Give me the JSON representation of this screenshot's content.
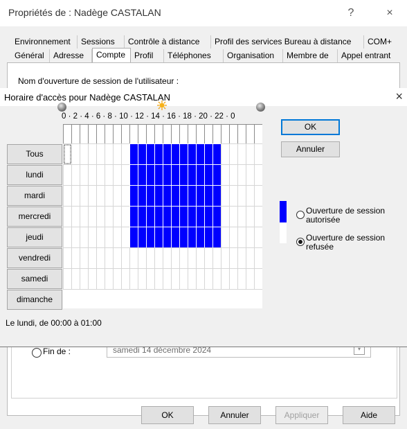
{
  "window": {
    "title": "Propriétés de : Nadège CASTALAN",
    "help": "?",
    "close": "×"
  },
  "tabs_row1": [
    "Environnement",
    "Sessions",
    "Contrôle à distance",
    "Profil des services Bureau à distance",
    "COM+"
  ],
  "tabs_row2": [
    "Général",
    "Adresse",
    "Compte",
    "Profil",
    "Téléphones",
    "Organisation",
    "Membre de",
    "Appel entrant"
  ],
  "selected_tab": "Compte",
  "behind": {
    "logon_label": "Nom d'ouverture de session de l'utilisateur :",
    "end_label": "Fin de :",
    "end_date": "samedi   14 décembre 2024"
  },
  "bottom_buttons": {
    "ok": "OK",
    "cancel": "Annuler",
    "apply": "Appliquer",
    "help": "Aide"
  },
  "dialog": {
    "title": "Horaire d'accès pour Nadège CASTALAN",
    "close": "×",
    "hour_scale": "0 · 2 · 4 · 6 · 8 · 10 · 12 · 14 · 16 · 18 · 20 · 22 · 0",
    "all_label": "Tous",
    "days": [
      "lundi",
      "mardi",
      "mercredi",
      "jeudi",
      "vendredi",
      "samedi",
      "dimanche"
    ],
    "ok": "OK",
    "cancel": "Annuler",
    "permitted_label": "Ouverture de session autorisée",
    "denied_label": "Ouverture de session refusée",
    "selected_option": "denied",
    "status": "Le lundi, de 00:00 à 01:00",
    "allowed_hours": {
      "start": 8,
      "end": 19
    },
    "allowed_days": [
      "lundi",
      "mardi",
      "mercredi",
      "jeudi",
      "vendredi"
    ],
    "focus_cell": {
      "day": "lundi",
      "hour": 0
    },
    "colors": {
      "allowed": "#0000ff",
      "denied": "#ffffff",
      "grid": "#d6d6d6"
    }
  }
}
